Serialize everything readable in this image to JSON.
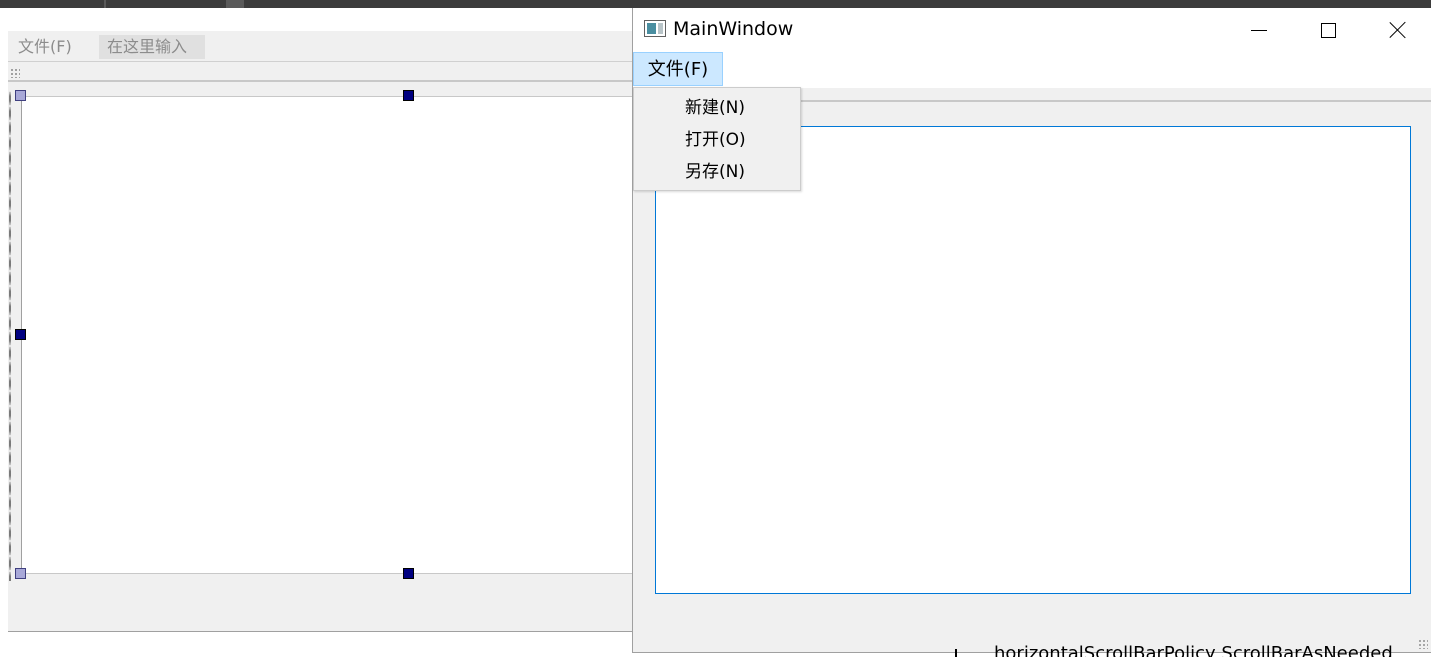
{
  "designer": {
    "menu_file_label": "文件(F)",
    "menu_type_here_label": "在这里输入"
  },
  "main_window": {
    "title": "MainWindow",
    "menu_file_label": "文件(F)",
    "file_menu": {
      "items": [
        {
          "label": "新建(N)"
        },
        {
          "label": "打开(O)"
        },
        {
          "label": "另存(N)"
        }
      ]
    }
  },
  "property_text": "horizontalScrollBarPolicy ScrollBarAsNeeded",
  "colors": {
    "menu_highlight": "#cce8ff",
    "focus_border": "#0078d7",
    "selection_handle": "#000080"
  }
}
